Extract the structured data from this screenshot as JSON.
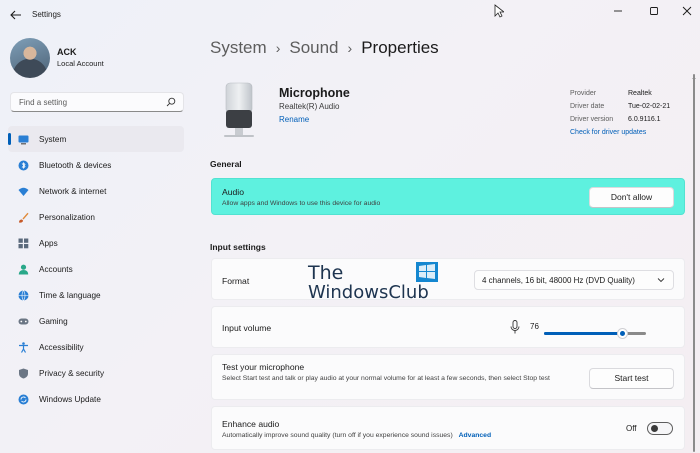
{
  "window": {
    "title": "Settings"
  },
  "profile": {
    "name": "ACK",
    "account_type": "Local Account"
  },
  "search": {
    "placeholder": "Find a setting"
  },
  "sidebar": {
    "items": [
      {
        "label": "System",
        "icon": "display-icon",
        "active": true
      },
      {
        "label": "Bluetooth & devices",
        "icon": "bluetooth-icon"
      },
      {
        "label": "Network & internet",
        "icon": "wifi-icon"
      },
      {
        "label": "Personalization",
        "icon": "brush-icon"
      },
      {
        "label": "Apps",
        "icon": "apps-grid-icon"
      },
      {
        "label": "Accounts",
        "icon": "person-icon"
      },
      {
        "label": "Time & language",
        "icon": "globe-clock-icon"
      },
      {
        "label": "Gaming",
        "icon": "gamepad-icon"
      },
      {
        "label": "Accessibility",
        "icon": "accessibility-icon"
      },
      {
        "label": "Privacy & security",
        "icon": "shield-icon"
      },
      {
        "label": "Windows Update",
        "icon": "update-icon"
      }
    ]
  },
  "breadcrumb": {
    "items": [
      "System",
      "Sound"
    ],
    "current": "Properties"
  },
  "device": {
    "name": "Microphone",
    "driver": "Realtek(R) Audio",
    "rename_label": "Rename",
    "properties": {
      "provider_label": "Provider",
      "provider": "Realtek",
      "date_label": "Driver date",
      "date": "Tue-02-02-21",
      "version_label": "Driver version",
      "version": "6.0.9116.1",
      "check_link": "Check for driver updates"
    }
  },
  "general": {
    "heading": "General",
    "audio": {
      "title": "Audio",
      "description": "Allow apps and Windows to use this device for audio",
      "button": "Don't allow"
    }
  },
  "input_settings": {
    "heading": "Input settings",
    "format": {
      "label": "Format",
      "value": "4 channels, 16 bit, 48000 Hz (DVD Quality)"
    },
    "volume": {
      "label": "Input volume",
      "value": 76,
      "value_text": "76"
    },
    "test": {
      "title": "Test your microphone",
      "description": "Select Start test and talk or play audio at your normal volume for at least a few seconds, then select Stop test",
      "button": "Start test"
    },
    "enhance": {
      "title": "Enhance audio",
      "description": "Automatically improve sound quality (turn off if you experience sound issues)",
      "advanced_link": "Advanced",
      "state": "Off"
    }
  },
  "watermark": {
    "line1": "The",
    "line2": "WindowsClub"
  },
  "colors": {
    "accent": "#005fb8",
    "highlight": "#5ef1df",
    "sidebar_active": "#eae9ef"
  }
}
